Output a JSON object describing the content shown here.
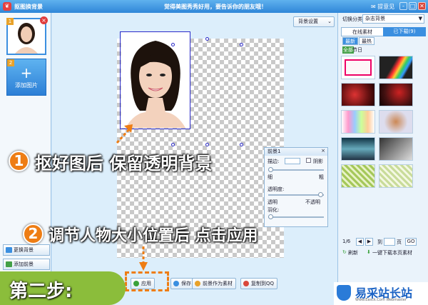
{
  "titlebar": {
    "app_title": "抠图换背景",
    "slogan": "觉得美图秀秀好用，要告诉你的朋友哦！",
    "feedback": "提意见",
    "min": "-",
    "max": "□",
    "close": "✕"
  },
  "left_panel": {
    "thumb_index": "1",
    "thumb_delete": "×",
    "add_index": "2",
    "add_plus": "+",
    "add_label": "添加图片",
    "change_bg": "更换背景",
    "add_fg": "添加前景"
  },
  "center": {
    "bg_settings": "背景设置",
    "filter_panel": {
      "title": "前景1",
      "close": "×",
      "feather_label": "描边:",
      "shadow_label": "阴影",
      "thin": "细",
      "thick": "粗",
      "transparency": "透明度:",
      "transparent": "透明",
      "opaque": "不透明",
      "feather": "羽化:",
      "stroke_level": 0.0,
      "opacity_level": 0.95,
      "feather_level": 0.0
    }
  },
  "bottom_toolbar": {
    "apply": "应用",
    "save": "保存",
    "save_as_material": "前景作为素材",
    "copy_to_qq": "复制到QQ"
  },
  "right_panel": {
    "category_label": "切换分类",
    "category_value": "杂志背景",
    "tabs": [
      "在线素材",
      "已下载(9)"
    ],
    "subtabs": [
      "最新",
      "最热"
    ],
    "filter_all": "全部",
    "filter_festival": "节日",
    "page_current": "1/6",
    "page_goto_label": "到",
    "page_unit": "页",
    "page_go": "GO",
    "refresh": "刷新",
    "download_page": "一键下载本页素材"
  },
  "overlays": {
    "step1_number": "1",
    "step1_text": "抠好图后 保留透明背景",
    "step2_number": "2",
    "step2_text": "调节人物大小位置后 点击应用",
    "step_badge": "第二步:",
    "watermark_main": "易采站长站",
    "watermark_sub": "Www.Easck.Com Webmaster"
  }
}
